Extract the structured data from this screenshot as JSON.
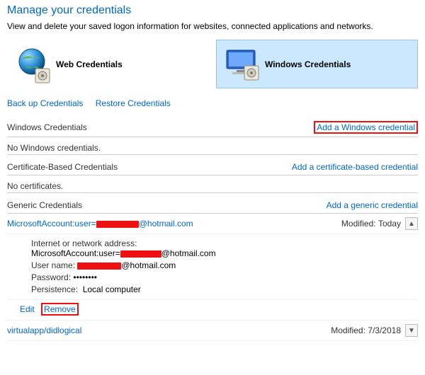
{
  "header": {
    "title": "Manage your credentials",
    "subtitle": "View and delete your saved logon information for websites, connected applications and networks."
  },
  "vaults": {
    "web": {
      "label": "Web Credentials"
    },
    "windows": {
      "label": "Windows Credentials"
    }
  },
  "links": {
    "backup": "Back up Credentials",
    "restore": "Restore Credentials"
  },
  "sections": {
    "windows": {
      "title": "Windows Credentials",
      "add": "Add a Windows credential",
      "empty": "No Windows credentials."
    },
    "cert": {
      "title": "Certificate-Based Credentials",
      "add": "Add a certificate-based credential",
      "empty": "No certificates."
    },
    "generic": {
      "title": "Generic Credentials",
      "add": "Add a generic credential"
    }
  },
  "modified_label": "Modified:",
  "credentials": [
    {
      "name_prefix": "MicrosoftAccount:user=",
      "name_suffix": "@hotmail.com",
      "modified": "Today",
      "expanded": true,
      "details": {
        "addr_label": "Internet or network address:",
        "addr_prefix": "MicrosoftAccount:user=",
        "addr_suffix": "@hotmail.com",
        "user_label": "User name:",
        "user_suffix": "@hotmail.com",
        "pwd_label": "Password:",
        "pwd_value": "••••••••",
        "persist_label": "Persistence:",
        "persist_value": "Local computer"
      }
    },
    {
      "name": "virtualapp/didlogical",
      "modified": "7/3/2018",
      "expanded": false
    }
  ],
  "actions": {
    "edit": "Edit",
    "remove": "Remove"
  }
}
